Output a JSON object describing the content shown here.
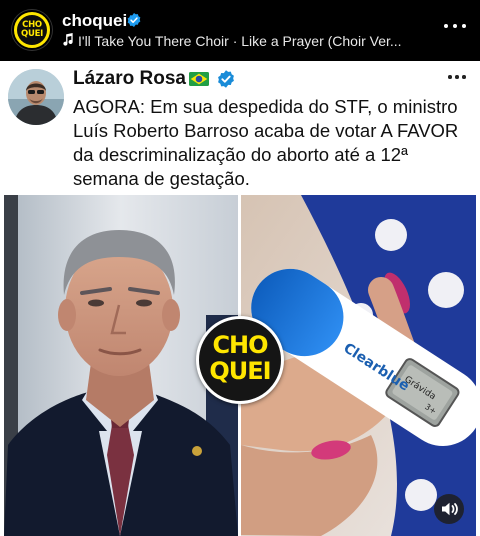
{
  "ig_header": {
    "username": "choquei",
    "avatar_text_line1": "CHO",
    "avatar_text_line2": "QUEI",
    "music_note_icon": "music-note-icon",
    "music_text": "I'll Take You There Choir · Like a Prayer (Choir Ver...",
    "more_icon": "more-horizontal-icon"
  },
  "post": {
    "author_name": "Lázaro Rosa",
    "flag_icon": "brazil-flag-icon",
    "verified_icon": "verified-badge-icon",
    "text": "AGORA: Em sua despedida do STF, o ministro Luís Roberto Barroso acaba de votar A FAVOR da descriminalização do aborto até a 12ª semana de gestação."
  },
  "media": {
    "badge_line1": "CHO",
    "badge_line2": "QUEI",
    "test_brand": "Clearblue",
    "test_display": "Grávida",
    "test_weeks": "3+",
    "sound_icon": "speaker-icon"
  },
  "colors": {
    "brand_yellow": "#ffe600",
    "verified_blue": "#1d9bf0",
    "x_verified_blue": "#1a8cd8"
  }
}
